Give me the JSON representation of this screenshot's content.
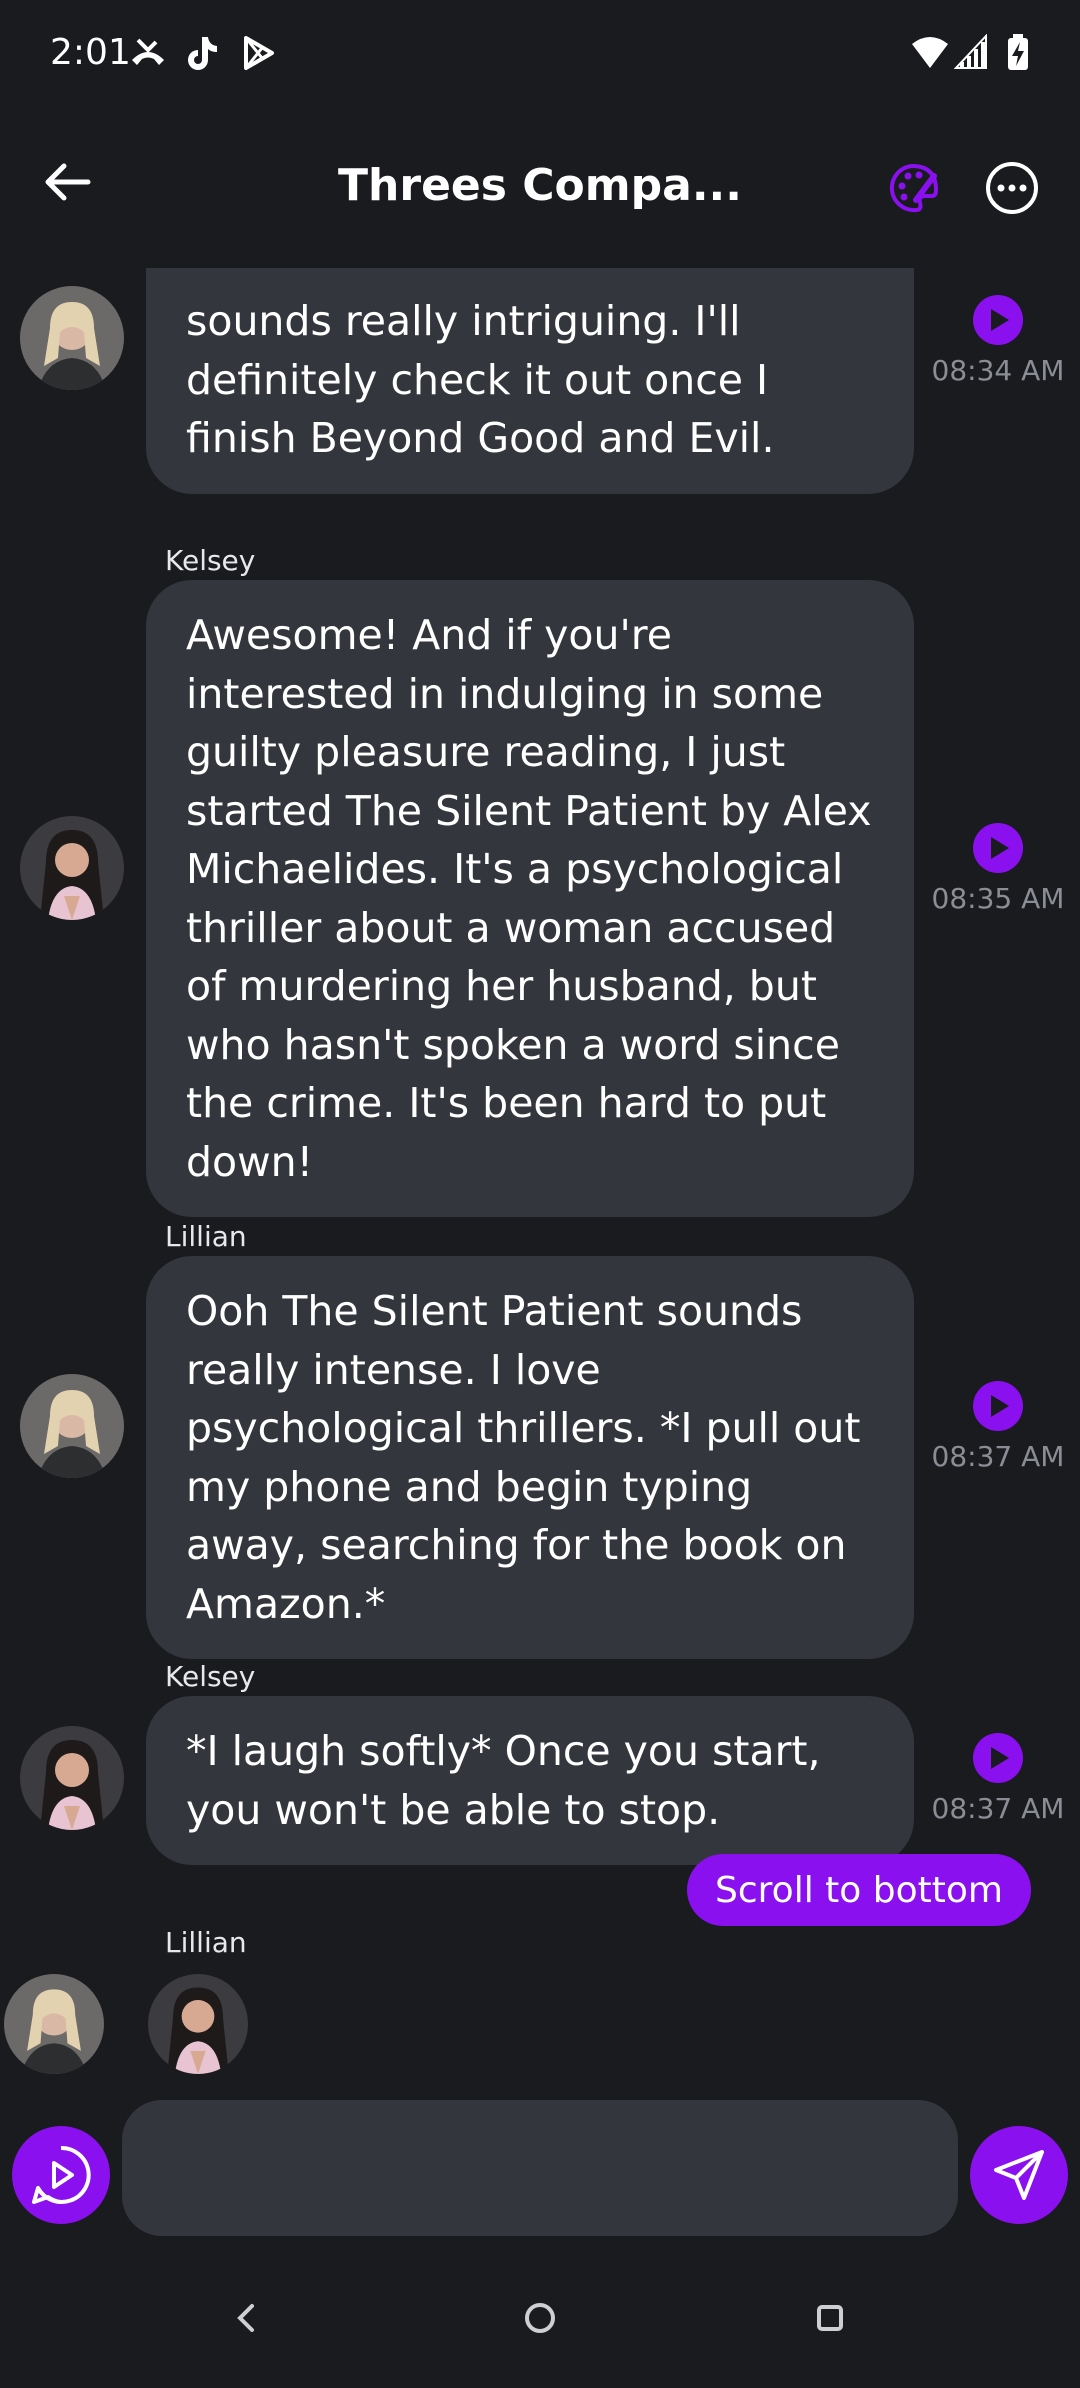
{
  "status_bar": {
    "time": "2:01"
  },
  "header": {
    "title": "Threes Compa..."
  },
  "messages": [
    {
      "text": "sounds really intriguing. I'll definitely check it out once I finish Beyond Good and Evil.",
      "time": "08:34 AM"
    },
    {
      "sender": "Kelsey",
      "text": "Awesome! And if you're interested in indulging in some guilty pleasure reading, I just started The Silent Patient by Alex Michaelides. It's a psychological thriller about a woman accused of murdering her husband, but who hasn't spoken a word since the crime. It's been hard to put down!",
      "time": "08:35 AM"
    },
    {
      "sender": "Lillian",
      "text": "Ooh The Silent Patient sounds really intense. I love psychological thrillers. *I pull out my phone and begin typing away, searching for the book on Amazon.*",
      "time": "08:37 AM"
    },
    {
      "sender": "Kelsey",
      "text": "*I laugh softly* Once you start, you won't be able to stop.",
      "time": "08:37 AM"
    }
  ],
  "typing": {
    "sender": "Lillian"
  },
  "scroll_button": "Scroll to bottom",
  "composer": {
    "placeholder": ""
  },
  "colors": {
    "accent": "#8b10f0",
    "bubble": "#34363d",
    "background": "#1a1b1f"
  }
}
